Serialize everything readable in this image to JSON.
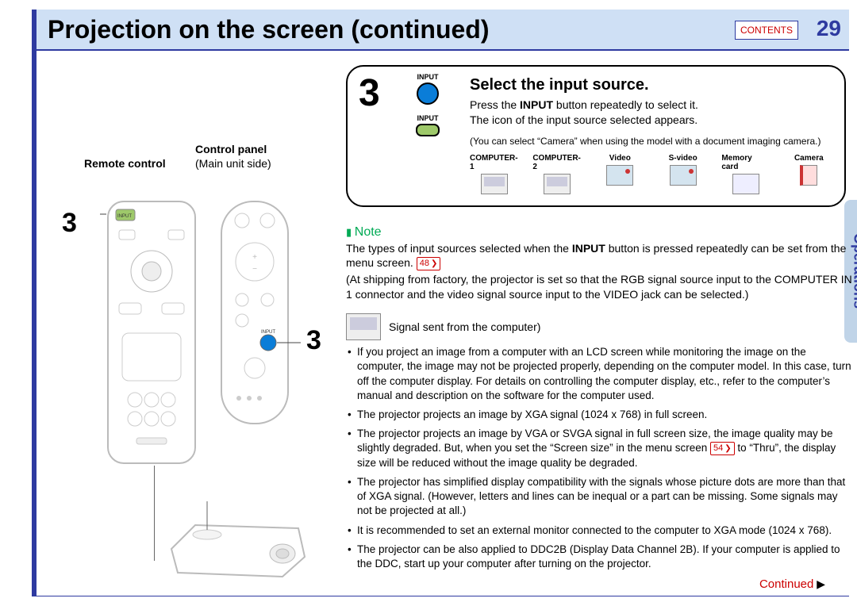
{
  "header": {
    "title": "Projection on the screen (continued)",
    "contents_btn": "CONTENTS",
    "page_num": "29"
  },
  "sidebar": {
    "tab": "Operations"
  },
  "left": {
    "remote_label": "Remote control",
    "panel_label": "Control panel",
    "main_unit_label": "(Main unit side)",
    "step_marker": "3"
  },
  "step": {
    "num": "3",
    "input_top": "INPUT",
    "input_bottom": "INPUT",
    "title": "Select the input source.",
    "line1a": "Press the ",
    "line1b": "INPUT",
    "line1c": " button repeatedly to select it.",
    "line2": "The icon of the input source selected appears.",
    "paren": "(You can select “Camera” when using the model with a document imaging camera.)",
    "sources": [
      "COMPUTER-1",
      "COMPUTER-2",
      "Video",
      "S-video",
      "Memory card",
      "Camera"
    ]
  },
  "note": {
    "head": "Note",
    "p1a": "The types of input sources selected when the ",
    "p1b": "INPUT",
    "p1c": " button is pressed repeatedly can be set from the menu screen. ",
    "ref48": "48",
    "p2": "(At shipping from factory, the projector is set so that the RGB signal source input to the COMPUTER IN 1 connector and the video signal source input to the VIDEO jack can be selected.)",
    "sig": "Signal sent from the computer)",
    "bullets": [
      "If you project an image from a computer with an LCD screen while monitoring the image on the computer, the image may not be projected properly, depending on the computer model. In this case, turn off the computer display. For details on controlling the computer display, etc., refer to the computer’s manual and description on the software for the computer used.",
      "The projector projects an image by XGA signal (1024 x 768) in full screen.",
      "__B3__",
      "The projector has simplified display compatibility with the signals whose picture dots are more than that of XGA signal. (However, letters and lines can be inequal or a part can be missing. Some signals may not be projected at all.)",
      "It is recommended to set an external monitor connected to the computer to XGA mode (1024 x 768).",
      "The projector can be also applied to DDC2B (Display Data Channel 2B). If your computer is applied to the DDC, start up your computer after turning on the projector."
    ],
    "b3a": "The projector projects an image by VGA or SVGA signal in full screen size, the image quality may be slightly degraded. But, when you set the “Screen size” in the menu screen ",
    "ref54": "54",
    "b3b": " to “Thru”, the display size will be reduced without the image quality be degraded."
  },
  "footer": {
    "continued": "Continued"
  }
}
